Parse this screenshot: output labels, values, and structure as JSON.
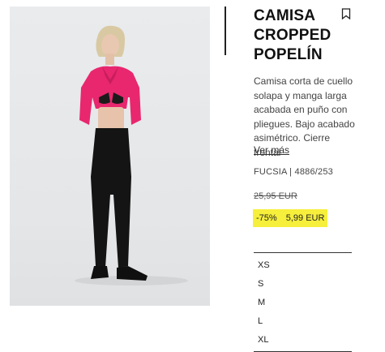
{
  "product": {
    "title": "CAMISA CROPPED POPELÍN",
    "description": "Camisa corta de cuello\nsolapa y manga larga\nacabada en puño con\npliegues. Bajo acabado\nasimétrico. Cierre frontal",
    "see_more": "Ver más",
    "reference": "FUCSIA | 4886/253",
    "old_price": "25,95 EUR",
    "discount": "-75%",
    "price": "5,99 EUR",
    "sizes": [
      "XS",
      "S",
      "M",
      "L",
      "XL"
    ]
  },
  "colors": {
    "sale_highlight": "#f6ef3b",
    "shirt": "#e8276f",
    "text": "#1a1a1a"
  },
  "icons": {
    "bookmark": "bookmark-icon"
  }
}
